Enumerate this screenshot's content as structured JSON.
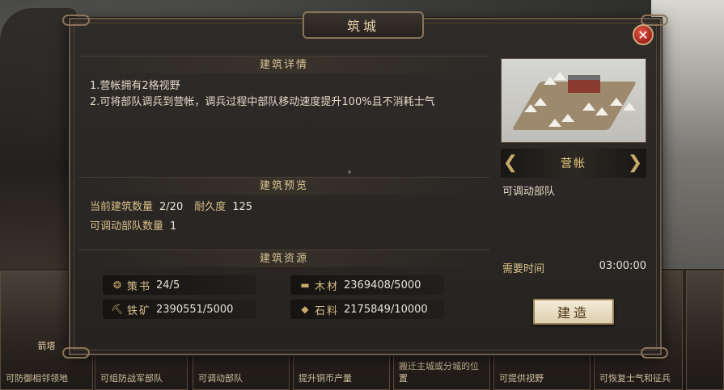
{
  "dialog": {
    "title": "筑城",
    "close_symbol": "✕"
  },
  "details": {
    "header": "建筑详情",
    "lines": [
      "1.营帐拥有2格视野",
      "2.可将部队调兵到营帐，调兵过程中部队移动速度提升100%且不消耗士气"
    ]
  },
  "preview": {
    "header": "建筑预览",
    "count_label": "当前建筑数量",
    "count_value": "2/20",
    "durability_label": "耐久度",
    "durability_value": "125",
    "troops_label": "可调动部队数量",
    "troops_value": "1"
  },
  "resources": {
    "header": "建筑资源",
    "items": [
      {
        "icon": "scroll-icon",
        "glyph": "❂",
        "name": "策书",
        "value": "24/5"
      },
      {
        "icon": "wood-icon",
        "glyph": "▬",
        "name": "木材",
        "value": "2369408/5000"
      },
      {
        "icon": "iron-icon",
        "glyph": "⛏",
        "name": "铁矿",
        "value": "2390551/5000"
      },
      {
        "icon": "stone-icon",
        "glyph": "◆",
        "name": "石料",
        "value": "2175849/10000"
      }
    ]
  },
  "building": {
    "name": "营帐",
    "description": "可调动部队",
    "time_label": "需要时间",
    "time_value": "03:00:00",
    "build_label": "建造",
    "prev_arrow": "❮",
    "next_arrow": "❯"
  },
  "background_cards": [
    {
      "name": "箭塔",
      "text": "可防御相邻领地"
    },
    {
      "name": "",
      "text": "可组防战军部队"
    },
    {
      "name": "",
      "text": "可调动部队"
    },
    {
      "name": "",
      "text": "提升铜币产量"
    },
    {
      "name": "",
      "text": "搬迁主城或分城的位置"
    },
    {
      "name": "",
      "text": "可提供视野"
    },
    {
      "name": "",
      "text": "可恢复士气和征兵"
    }
  ],
  "colors": {
    "accent_gold": "#d8c08a",
    "close_red": "#a4231c",
    "panel_bg": "#2e2b28"
  }
}
